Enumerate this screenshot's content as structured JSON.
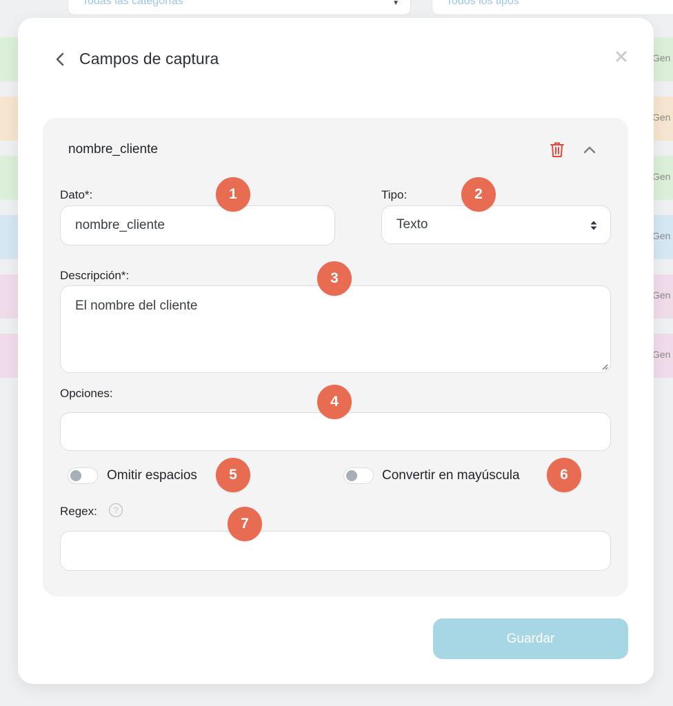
{
  "background": {
    "category_filter": "Todas las categorías",
    "type_filter": "Todos los tipos",
    "row_label": "Gen",
    "row_colors": [
      "#dcefd8",
      "#f6e6cf",
      "#dcefd8",
      "#d5e7f2",
      "#f0dbea",
      "#f0dbea"
    ]
  },
  "modal": {
    "title": "Campos de captura",
    "back_icon": "chevron-left-icon",
    "close_icon": "close-icon"
  },
  "field_card": {
    "title": "nombre_cliente",
    "delete_icon": "trash-icon",
    "collapse_icon": "chevron-up-icon",
    "dato": {
      "label": "Dato*:",
      "value": "nombre_cliente"
    },
    "tipo": {
      "label": "Tipo:",
      "selected": "Texto"
    },
    "descripcion": {
      "label": "Descripción*:",
      "value": "El nombre del cliente"
    },
    "opciones": {
      "label": "Opciones:",
      "value": ""
    },
    "omitir_espacios": {
      "label": "Omitir espacios",
      "checked": false
    },
    "convertir_mayuscula": {
      "label": "Convertir en mayúscula",
      "checked": false
    },
    "regex": {
      "label": "Regex:",
      "value": "",
      "help_icon": "question-circle-icon"
    }
  },
  "badges": [
    "1",
    "2",
    "3",
    "4",
    "5",
    "6",
    "7"
  ],
  "footer": {
    "save_label": "Guardar"
  },
  "colors": {
    "accent_badge": "#e76c52",
    "save_button": "#a7d7e4",
    "delete": "#e5483b"
  }
}
